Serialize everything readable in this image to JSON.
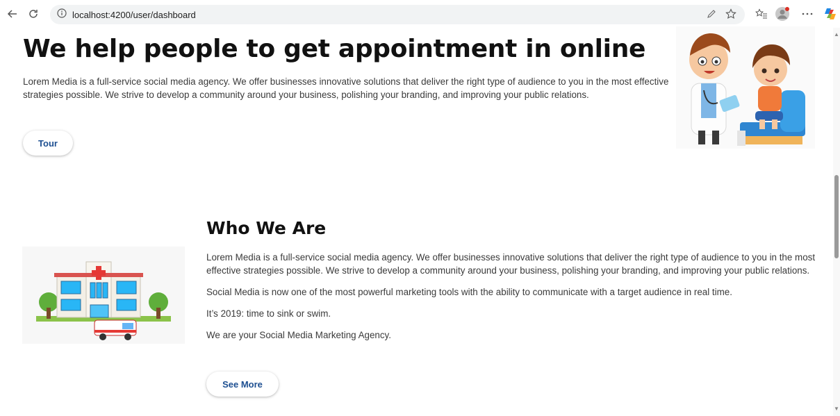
{
  "browser": {
    "url": "localhost:4200/user/dashboard",
    "icons": [
      "back-icon",
      "reload-icon",
      "info-icon",
      "read-aloud-icon",
      "favorite-star-icon",
      "favorites-list-icon",
      "profile-icon",
      "more-icon",
      "copilot-icon"
    ]
  },
  "hero": {
    "title": "We help people to get appointment in online",
    "text": "Lorem Media is a full-service social media agency. We offer businesses innovative solutions that deliver the right type of audience to you in the most effective strategies possible. We strive to develop a community around your business, polishing your branding, and improving your public relations.",
    "button_label": "Tour",
    "image": "doctor-with-child-illustration"
  },
  "who": {
    "title": "Who We Are",
    "paragraphs": [
      "Lorem Media is a full-service social media agency. We offer businesses innovative solutions that deliver the right type of audience to you in the most effective strategies possible. We strive to develop a community around your business, polishing your branding, and improving your public relations.",
      "Social Media is now one of the most powerful marketing tools with the ability to communicate with a target audience in real time.",
      "It’s 2019: time to sink or swim.",
      "We are your Social Media Marketing Agency."
    ],
    "button_label": "See More",
    "image": "hospital-building-illustration"
  },
  "colors": {
    "button_text": "#1d4f91",
    "heading": "#111111",
    "body_text": "#3a3a3a"
  }
}
